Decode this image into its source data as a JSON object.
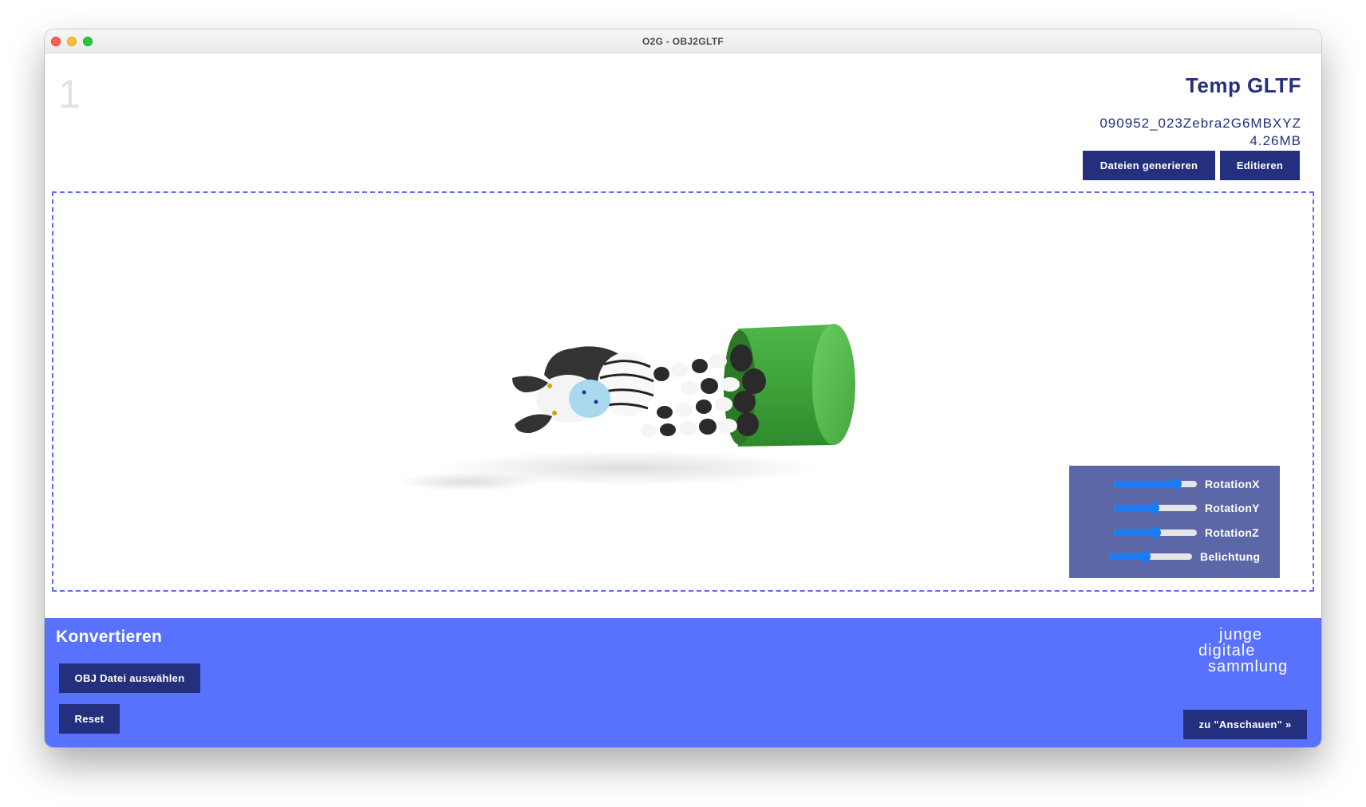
{
  "window": {
    "title": "O2G - OBJ2GLTF"
  },
  "step": {
    "number": "1"
  },
  "model": {
    "title": "Temp GLTF",
    "file_name": "090952_023Zebra2G6MBXYZ",
    "file_size": "4.26MB"
  },
  "toolbar": {
    "generate_label": "Dateien generieren",
    "edit_label": "Editieren"
  },
  "controls": [
    {
      "label": "RotationX",
      "value": 0.75
    },
    {
      "label": "RotationY",
      "value": 0.48
    },
    {
      "label": "RotationZ",
      "value": 0.5
    },
    {
      "label": "Belichtung",
      "value": 0.43
    }
  ],
  "convert": {
    "title": "Konvertieren",
    "choose_label": "OBJ Datei auswählen",
    "reset_label": "Reset",
    "view_label": "zu \"Anschauen\" »"
  },
  "logo": {
    "lines": [
      "junge",
      "digitale",
      "sammlung"
    ]
  },
  "colors": {
    "navy": "#24307d",
    "panel_blue": "#5872fd",
    "controls_bg": "#5c67a8",
    "slider_blue": "#1a7cf5",
    "viewport_border": "#5b6ef2"
  },
  "icons": [
    "close-icon",
    "minimize-icon",
    "zoom-icon"
  ]
}
